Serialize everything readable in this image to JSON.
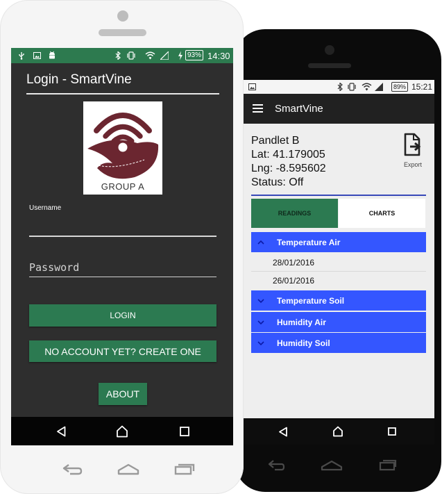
{
  "colors": {
    "accent_green": "#2c7a51",
    "accent_blue": "#3456ff",
    "divider_blue": "#3748b8",
    "logo_maroon": "#6b2630"
  },
  "login_phone": {
    "status_bar": {
      "left_icons": [
        "usb-icon",
        "image-icon",
        "android-icon"
      ],
      "right_icons": [
        "bluetooth-icon",
        "vibrate-icon",
        "wifi-icon",
        "signal-icon",
        "battery-charging-icon"
      ],
      "battery": "93%",
      "time": "14:30"
    },
    "title": "Login - SmartVine",
    "logo": {
      "icon": "smartvine-logo-icon",
      "text": "GROUP A"
    },
    "username_label": "Username",
    "password_placeholder": "Password",
    "login_button": "LOGIN",
    "create_account_button": "NO ACCOUNT YET? CREATE ONE",
    "about_button": "ABOUT",
    "nav": [
      "back-icon",
      "home-icon",
      "recents-icon"
    ],
    "hardware_keys": [
      "back-icon",
      "home-icon",
      "recents-icon"
    ]
  },
  "detail_phone": {
    "status_bar": {
      "left_icons": [
        "image-icon"
      ],
      "right_icons": [
        "bluetooth-icon",
        "vibrate-icon",
        "wifi-icon",
        "signal-icon"
      ],
      "battery": "89%",
      "time": "15:21"
    },
    "toolbar": {
      "menu_icon": "menu-icon",
      "title": "SmartVine"
    },
    "device": {
      "name": "Pandlet B",
      "lat": "Lat: 41.179005",
      "lng": "Lng: -8.595602",
      "status": "Status: Off"
    },
    "export_label": "Export",
    "tabs": [
      {
        "label": "READINGS",
        "selected": true
      },
      {
        "label": "CHARTS",
        "selected": false
      }
    ],
    "groups": [
      {
        "label": "Temperature Air",
        "expanded": true,
        "children": [
          "28/01/2016",
          "26/01/2016"
        ]
      },
      {
        "label": "Temperature Soil",
        "expanded": false
      },
      {
        "label": "Humidity Air",
        "expanded": false
      },
      {
        "label": "Humidity Soil",
        "expanded": false
      }
    ],
    "nav": [
      "back-icon",
      "home-icon",
      "recents-icon"
    ],
    "hardware_keys": [
      "back-icon",
      "home-icon",
      "recents-icon"
    ]
  }
}
